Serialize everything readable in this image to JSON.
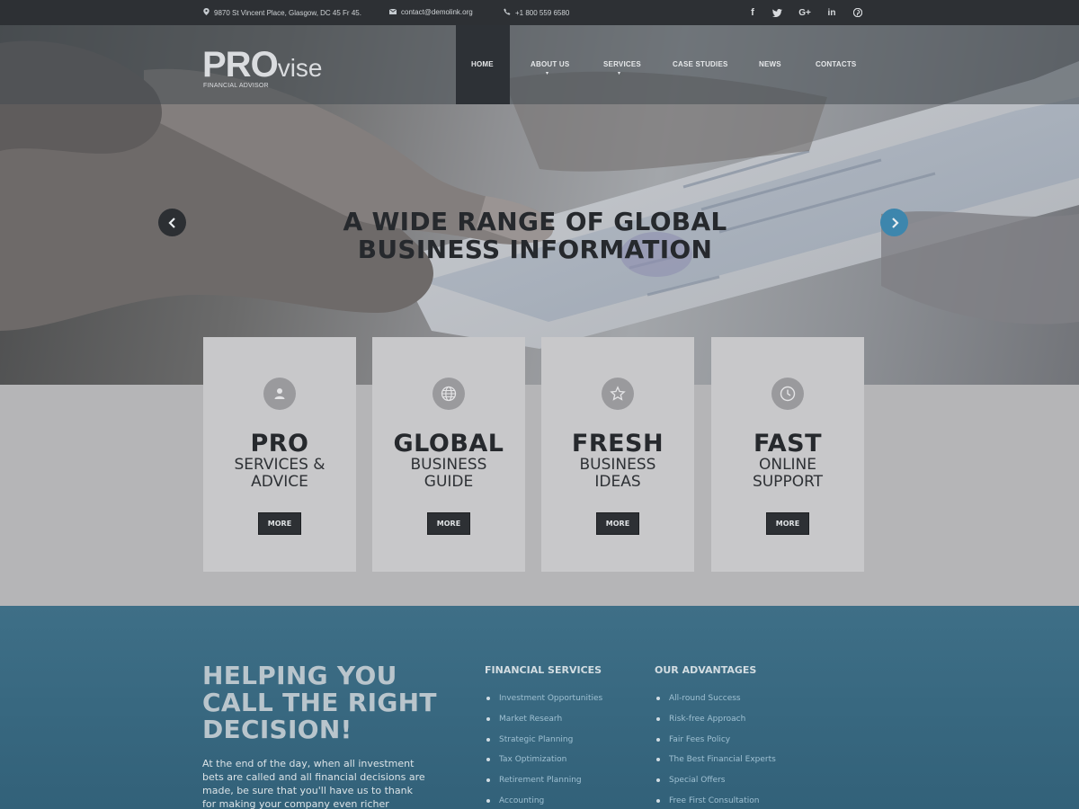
{
  "topbar": {
    "address": "9870 St Vincent Place, Glasgow, DC 45 Fr 45.",
    "email": "contact@demolink.org",
    "phone": "+1 800 559 6580",
    "social": [
      {
        "icon": "facebook-icon",
        "glyph": "f"
      },
      {
        "icon": "twitter-icon",
        "glyph": "t"
      },
      {
        "icon": "google-plus-icon",
        "glyph": "G+"
      },
      {
        "icon": "linkedin-icon",
        "glyph": "in"
      },
      {
        "icon": "pinterest-icon",
        "glyph": "p"
      }
    ]
  },
  "logo": {
    "bold": "PRO",
    "light": "vise",
    "tagline": "FINANCIAL ADVISOR"
  },
  "nav": {
    "items": [
      "HOME",
      "ABOUT US",
      "SERVICES",
      "CASE STUDIES",
      "NEWS",
      "CONTACTS"
    ],
    "active": "HOME"
  },
  "hero": {
    "title": "A WIDE RANGE OF GLOBAL BUSINESS INFORMATION"
  },
  "cards": [
    {
      "icon": "user-icon",
      "big": "PRO",
      "sub1": "SERVICES &",
      "sub2": "ADVICE",
      "button": "MORE"
    },
    {
      "icon": "globe-icon",
      "big": "GLOBAL",
      "sub1": "BUSINESS",
      "sub2": "GUIDE",
      "button": "MORE"
    },
    {
      "icon": "star-icon",
      "big": "FRESH",
      "sub1": "BUSINESS",
      "sub2": "IDEAS",
      "button": "MORE"
    },
    {
      "icon": "clock-icon",
      "big": "FAST",
      "sub1": "ONLINE",
      "sub2": "SUPPORT",
      "button": "MORE"
    }
  ],
  "help": {
    "title": "HELPING YOU CALL THE RIGHT DECISION!",
    "text": "At the end of the day, when all investment bets are called and all financial decisions are made, be sure that you'll have us to thank for making your company even richer"
  },
  "financial_services": {
    "title": "FINANCIAL SERVICES",
    "items": [
      "Investment Opportunities",
      "Market Researh",
      "Strategic Planning",
      "Tax Optimization",
      "Retirement Planning",
      "Accounting"
    ]
  },
  "advantages": {
    "title": "OUR ADVANTAGES",
    "items": [
      "All-round Success",
      "Risk-free Approach",
      "Fair Fees Policy",
      "The Best Financial Experts",
      "Special Offers",
      "Free First Consultation"
    ]
  },
  "colors": {
    "topbar": "#2d3034",
    "accent_blue": "#3d86ad",
    "footer_blue": "#3a6a82",
    "card_bg": "#c8c8ca"
  }
}
